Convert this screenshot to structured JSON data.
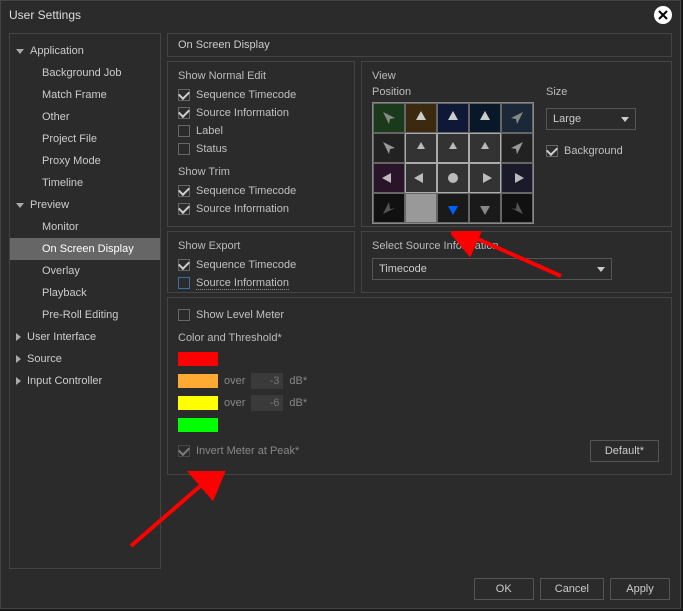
{
  "title": "User Settings",
  "sidebar": {
    "items": [
      {
        "label": "Application"
      },
      {
        "label": "Background Job"
      },
      {
        "label": "Match Frame"
      },
      {
        "label": "Other"
      },
      {
        "label": "Project File"
      },
      {
        "label": "Proxy Mode"
      },
      {
        "label": "Timeline"
      },
      {
        "label": "Preview"
      },
      {
        "label": "Monitor"
      },
      {
        "label": "On Screen Display"
      },
      {
        "label": "Overlay"
      },
      {
        "label": "Playback"
      },
      {
        "label": "Pre-Roll Editing"
      },
      {
        "label": "User Interface"
      },
      {
        "label": "Source"
      },
      {
        "label": "Input Controller"
      }
    ]
  },
  "sectionTitle": "On Screen Display",
  "normalEdit": {
    "title": "Show Normal Edit",
    "checks": [
      "Sequence Timecode",
      "Source Information",
      "Label",
      "Status"
    ]
  },
  "trim": {
    "title": "Show Trim",
    "checks": [
      "Sequence Timecode",
      "Source Information"
    ]
  },
  "export": {
    "title": "Show Export",
    "checks": [
      "Sequence Timecode",
      "Source Information"
    ]
  },
  "view": {
    "title": "View",
    "position": "Position",
    "size": "Size",
    "sizeValue": "Large",
    "background": "Background"
  },
  "ssi": {
    "title": "Select Source Information",
    "value": "Timecode"
  },
  "level": {
    "title": "Show Level Meter",
    "sub": "Color and Threshold*",
    "over": "over",
    "v1": "-3",
    "v2": "-6",
    "db": "dB*",
    "invert": "Invert Meter at Peak*",
    "default": "Default*"
  },
  "footer": {
    "ok": "OK",
    "cancel": "Cancel",
    "apply": "Apply"
  }
}
